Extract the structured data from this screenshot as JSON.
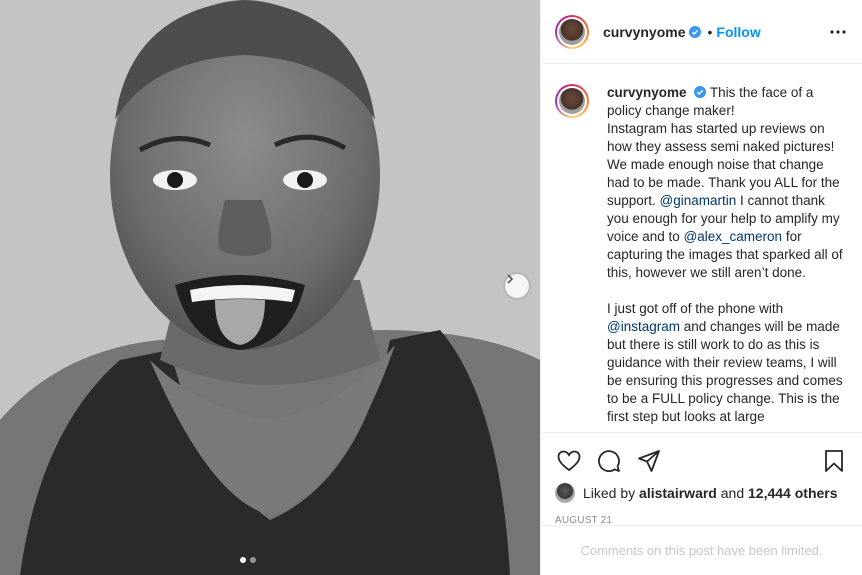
{
  "post": {
    "username": "curvynyome",
    "follow_label": "Follow",
    "separator": "•",
    "caption_lines_1": "This the face of a policy change maker!",
    "caption_p1_a": "Instagram has started up reviews on how they assess semi naked pictures! We made enough noise that change had to be made. Thank you ALL for the support. ",
    "mention_1": "@ginamartin",
    "caption_p1_b": " I cannot thank you enough for your help to amplify my voice and to ",
    "mention_2": "@alex_cameron",
    "caption_p1_c": " for capturing the images that sparked all of this, however we still aren’t done.",
    "caption_p2_a": "I just got off of the phone with ",
    "mention_3": "@instagram",
    "caption_p2_b": " and changes will be made but there is still work to do as this is guidance with their review teams, I will be ensuring this progresses and comes to be a FULL policy change.",
    "caption_p2_c": "This is the first step but looks at large"
  },
  "engagement": {
    "liked_by_prefix": "Liked by",
    "liked_by_user": "alistairward",
    "and_label": "and",
    "others_count": "12,444 others",
    "date": "AUGUST 21",
    "comments_limited": "Comments on this post have been limited."
  },
  "icons": {
    "verified": "verified-badge-icon",
    "more": "more-options-icon",
    "like": "heart-icon",
    "comment": "comment-icon",
    "share": "share-icon",
    "save": "bookmark-icon",
    "next": "chevron-right-icon"
  },
  "colors": {
    "accent": "#0095f6",
    "mention": "#00376b",
    "muted": "#8e8e8e"
  }
}
